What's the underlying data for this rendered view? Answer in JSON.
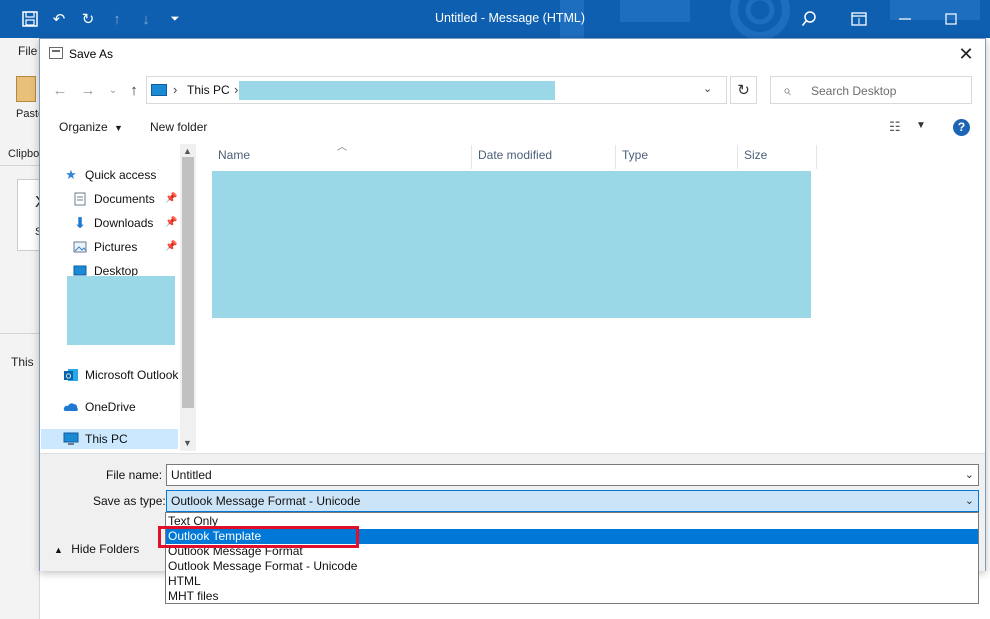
{
  "window": {
    "title": "Untitled  -  Message (HTML)"
  },
  "outlook_bg": {
    "file_tab": "File",
    "paste": "Paste",
    "clipboard": "Clipbo",
    "letter1": "X",
    "letter2": "S",
    "this_text": "This"
  },
  "dialog": {
    "title": "Save As",
    "close": "✕",
    "address": {
      "location": "This PC",
      "separator": "›"
    },
    "search": {
      "placeholder": "Search Desktop"
    },
    "toolbar": {
      "organize": "Organize",
      "new_folder": "New folder",
      "help": "?"
    },
    "nav": {
      "quick_access": "Quick access",
      "documents": "Documents",
      "downloads": "Downloads",
      "pictures": "Pictures",
      "desktop": "Desktop",
      "outlook": "Microsoft Outlook",
      "onedrive": "OneDrive",
      "this_pc": "This PC"
    },
    "columns": [
      "Name",
      "Date modified",
      "Type",
      "Size"
    ],
    "form": {
      "file_name_label": "File name:",
      "file_name_value": "Untitled",
      "save_type_label": "Save as type:",
      "save_type_value": "Outlook Message Format - Unicode",
      "hide_folders": "Hide Folders"
    },
    "save_type_options": [
      "Text Only",
      "Outlook Template",
      "Outlook Message Format",
      "Outlook Message Format - Unicode",
      "HTML",
      "MHT files"
    ],
    "selected_option_index": 1
  },
  "colors": {
    "title_bar": "#0f5fb0",
    "selection": "#0078d7",
    "highlight": "#e0102a",
    "redaction": "#9ad8e8"
  }
}
